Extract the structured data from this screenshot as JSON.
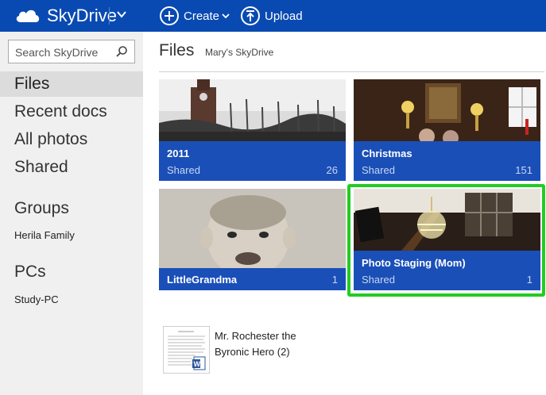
{
  "app": {
    "name": "SkyDrive"
  },
  "toolbar": {
    "create_label": "Create",
    "upload_label": "Upload"
  },
  "search": {
    "placeholder": "Search SkyDrive"
  },
  "sidebar": {
    "items": [
      {
        "label": "Files",
        "active": true
      },
      {
        "label": "Recent docs"
      },
      {
        "label": "All photos"
      },
      {
        "label": "Shared"
      }
    ],
    "groups_header": "Groups",
    "groups": [
      {
        "label": "Herila Family"
      }
    ],
    "pcs_header": "PCs",
    "pcs": [
      {
        "label": "Study-PC"
      }
    ]
  },
  "main": {
    "title": "Files",
    "breadcrumb": "Mary's SkyDrive",
    "folders": [
      {
        "name": "2011",
        "status": "Shared",
        "count": "26"
      },
      {
        "name": "Christmas",
        "status": "Shared",
        "count": "151"
      },
      {
        "name": "LittleGrandma",
        "status": "",
        "count": "1"
      },
      {
        "name": "Photo Staging (Mom)",
        "status": "Shared",
        "count": "1",
        "selected": true
      }
    ],
    "documents": [
      {
        "name": "Mr. Rochester the Byronic Hero (2)"
      }
    ]
  },
  "colors": {
    "topbar": "#094ab2",
    "tile": "#1a4fb8",
    "selection": "#22cc22",
    "sidebar": "#f0f0f0"
  }
}
